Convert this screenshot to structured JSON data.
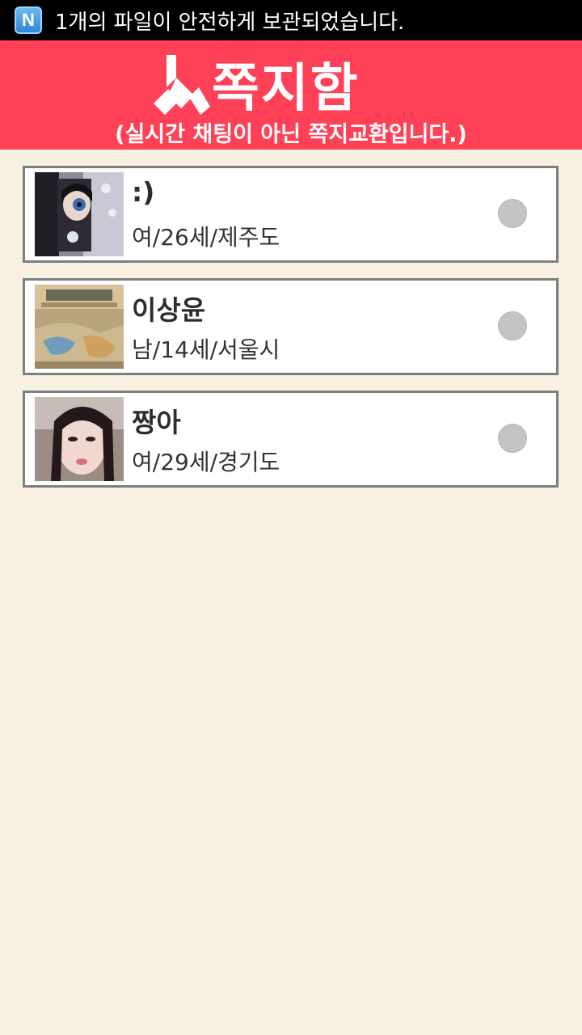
{
  "status_bar": {
    "icon": "naver-n-icon",
    "icon_letter": "N",
    "notification": "1개의 파일이 안전하게 보관되었습니다."
  },
  "header": {
    "title": "쪽지함",
    "subtitle": "(실시간 채팅이 아닌 쪽지교환입니다.)",
    "background_color": "#ff4157"
  },
  "items": [
    {
      "name": ":)",
      "info": "여/26세/제주도",
      "selected": false
    },
    {
      "name": "이상윤",
      "info": "남/14세/서울시",
      "selected": false
    },
    {
      "name": "짱아",
      "info": "여/29세/경기도",
      "selected": false
    }
  ]
}
